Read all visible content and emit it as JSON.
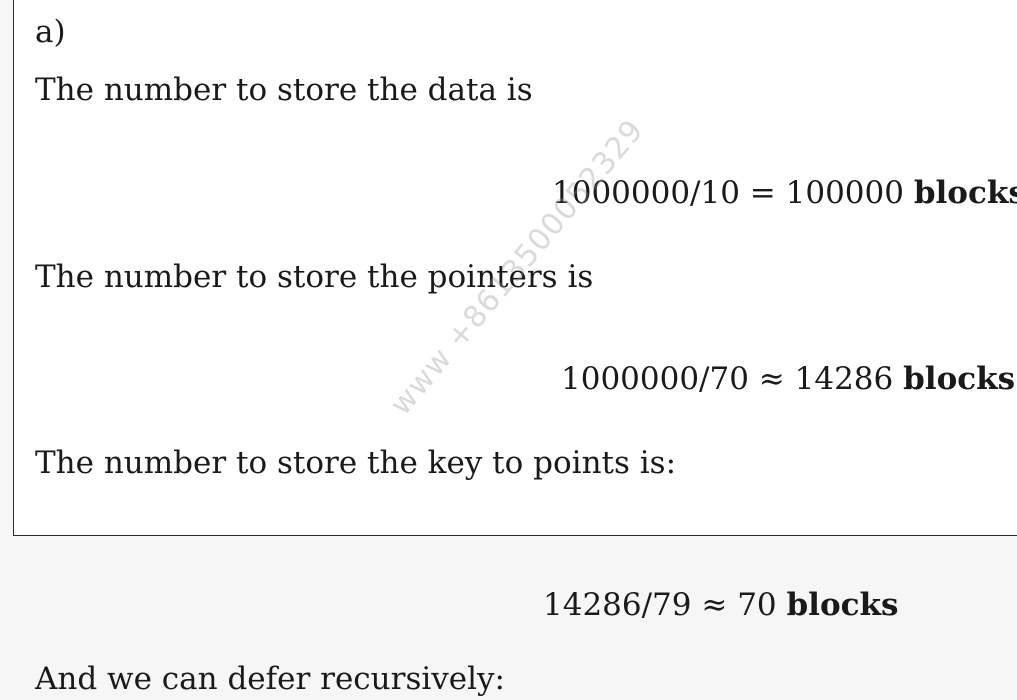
{
  "part_label": "a)",
  "line_data": "The number to store the data is",
  "eq_data": {
    "expr": "1000000/10 = 100000",
    "unit": "blocks"
  },
  "line_pointers": "The number to store the pointers is",
  "eq_pointers": {
    "expr": "1000000/70 ≈ 14286",
    "unit": "blocks"
  },
  "line_key": "The number to store the key to points is:",
  "eq_key": {
    "expr": "14286/79 ≈ 70",
    "unit": "blocks"
  },
  "line_recursive": "And we can defer recursively:",
  "watermark": "www +8613500052329"
}
